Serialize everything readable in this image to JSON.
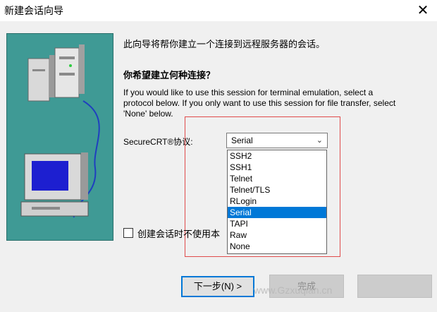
{
  "window": {
    "title": "新建会话向导",
    "close_glyph": "✕"
  },
  "intro_text": "此向导将帮你建立一个连接到远程服务器的会话。",
  "question": "你希望建立何种连接？",
  "description": "If you would like to use this session for terminal emulation, select a protocol below.  If you only want to use this session for file transfer, select 'None' below.",
  "protocol": {
    "label": "SecureCRT®协议:",
    "selected": "Serial",
    "options": [
      "SSH2",
      "SSH1",
      "Telnet",
      "Telnet/TLS",
      "RLogin",
      "Serial",
      "TAPI",
      "Raw",
      "None"
    ]
  },
  "checkbox_label": "创建会话时不使用本",
  "buttons": {
    "next": "下一步(N) >",
    "finish": "完成"
  },
  "watermark": "www.Gzxuqian.cn",
  "colors": {
    "selection": "#0078d7",
    "annotation": "#e04b4b",
    "art_bg": "#3f9a95"
  }
}
